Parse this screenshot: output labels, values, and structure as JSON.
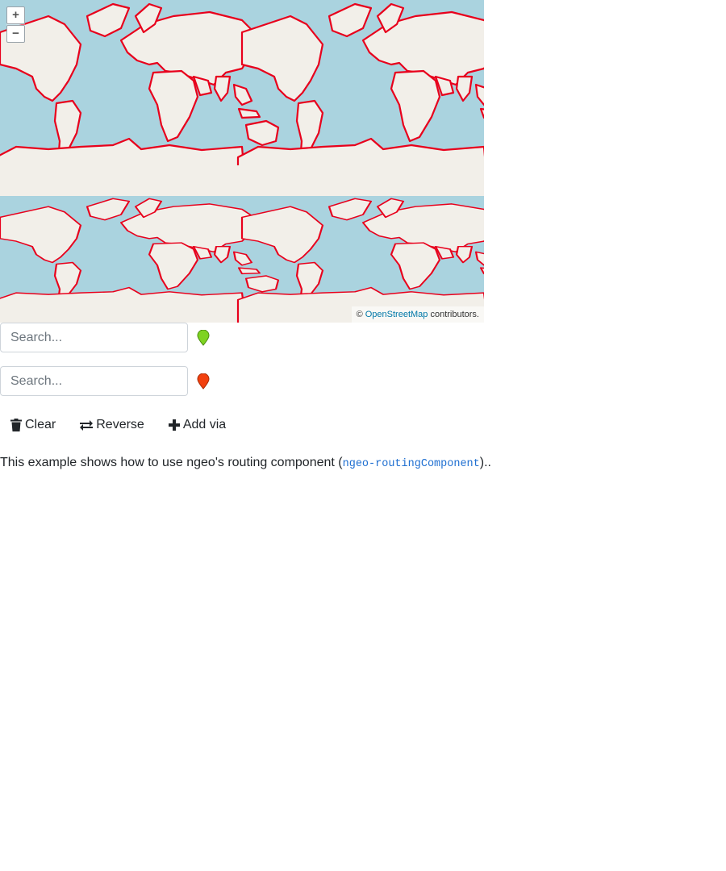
{
  "map": {
    "zoom_in_label": "+",
    "zoom_out_label": "−",
    "attribution_prefix": "© ",
    "attribution_link": "OpenStreetMap",
    "attribution_suffix": " contributors.",
    "colors": {
      "ocean": "#aad3df",
      "land": "#f2efe9",
      "border": "#e8001c"
    }
  },
  "routing": {
    "start": {
      "placeholder": "Search...",
      "value": "",
      "pin_color": "#7ed321",
      "pin_icon": "map-marker-icon"
    },
    "end": {
      "placeholder": "Search...",
      "value": "",
      "pin_color": "#f2400e",
      "pin_icon": "map-marker-icon"
    },
    "buttons": {
      "clear": {
        "label": "Clear",
        "icon": "trash-icon"
      },
      "reverse": {
        "label": "Reverse",
        "icon": "exchange-icon"
      },
      "add_via": {
        "label": "Add via",
        "icon": "plus-icon"
      }
    }
  },
  "description": {
    "before": "This example shows how to use ngeo's routing component (",
    "code": "ngeo-routingComponent",
    "after": ").."
  }
}
